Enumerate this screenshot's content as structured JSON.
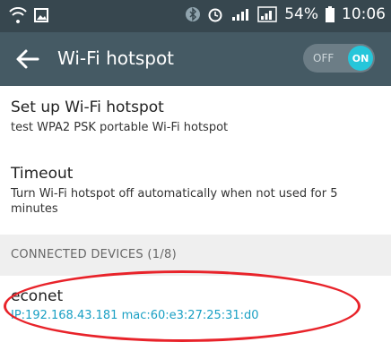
{
  "status_bar": {
    "left_icons": [
      "wifi-hotspot-icon",
      "gallery-icon"
    ],
    "battery_percent": "54%",
    "time": "10:06"
  },
  "app_bar": {
    "title": "Wi-Fi hotspot",
    "toggle_off_label": "OFF",
    "toggle_on_label": "ON",
    "toggle_state": "on"
  },
  "settings": {
    "setup": {
      "title": "Set up Wi-Fi hotspot",
      "subtitle": "test WPA2 PSK portable Wi-Fi hotspot"
    },
    "timeout": {
      "title": "Timeout",
      "subtitle": "Turn Wi-Fi hotspot off automatically when not used for 5 minutes"
    }
  },
  "connected": {
    "header": "CONNECTED DEVICES (1/8)",
    "devices": [
      {
        "name": "econet",
        "info": "IP:192.168.43.181  mac:60:e3:27:25:31:d0"
      }
    ]
  },
  "colors": {
    "status_bar": "#37474f",
    "app_bar": "#455a64",
    "accent": "#26c6da",
    "device_info": "#1aa0c4",
    "highlight": "#e8232a"
  }
}
